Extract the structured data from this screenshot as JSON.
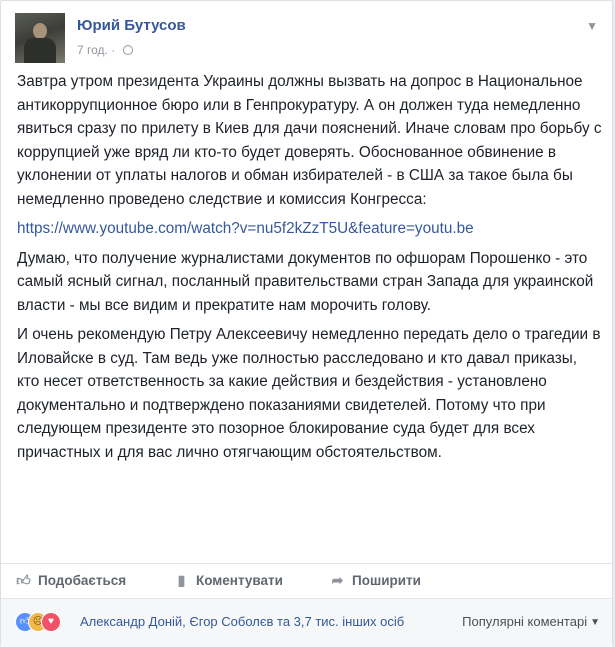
{
  "post": {
    "author": "Юрий Бутусов",
    "time": "7 год.",
    "dot": "·",
    "paragraphs": [
      "Завтра утром президента Украины должны вызвать на допрос в Национальное антикоррупционное бюро или в Генпрокуратуру. А он должен туда немедленно явиться сразу по прилету в Киев для дачи пояснений. Иначе словам про борьбу с коррупцией уже вряд ли кто-то будет доверять. Обоснованное обвинение в уклонении от уплаты налогов и обман избирателей - в США за такое была бы немедленно проведено следствие и комиссия Конгресса:",
      "Думаю, что получение журналистами документов по офшорам Порошенко - это самый ясный сигнал, посланный правительствами стран Запада для украинской власти - мы все видим и прекратите нам морочить голову.",
      "И очень рекомендую Петру Алексеевичу немедленно передать дело о трагедии в Иловайске в суд. Там ведь уже полностью расследовано и кто давал приказы, кто несет ответственность за какие действия и бездействия - установлено документально и подтверждено показаниями свидетелей. Потому что при следующем президенте это позорное блокирование суда будет для всех причастных и для вас лично отягчающим обстоятельством."
    ],
    "link": "https://www.youtube.com/watch?v=nu5f2kZzT5U&feature=youtu.be"
  },
  "actions": {
    "like": "Подобається",
    "comment": "Коментувати",
    "share": "Поширити"
  },
  "footer": {
    "reactors": "Александр Доній, Єгор Соболєв та 3,7 тис. інших осіб",
    "sort_label": "Популярні коментарі"
  },
  "icons": [
    "globe-icon",
    "chevron-down-icon",
    "thumbs-up-icon",
    "comment-icon",
    "share-icon",
    "like-reaction-icon",
    "angry-reaction-icon",
    "love-reaction-icon"
  ]
}
